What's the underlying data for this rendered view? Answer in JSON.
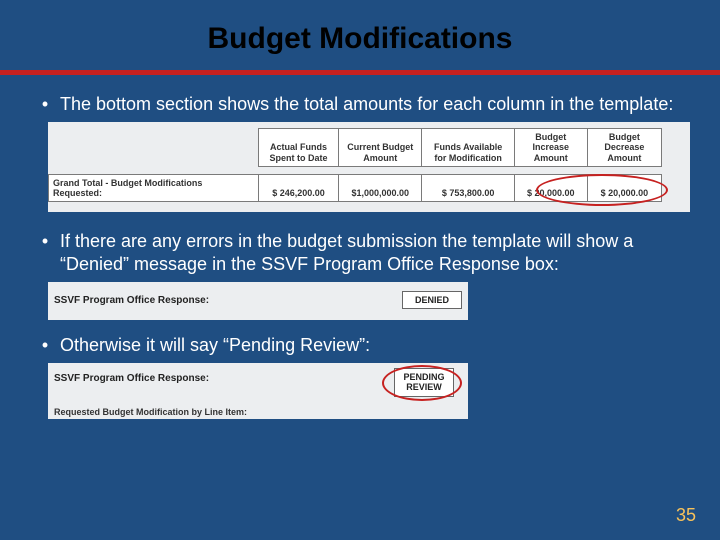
{
  "title": "Budget Modifications",
  "bullets": {
    "b1": "The bottom section shows the total amounts for each column in the template:",
    "b2": "If there are any errors in the budget submission the template will show a “Denied” message in the SSVF Program Office Response box:",
    "b3": "Otherwise it will say “Pending Review”:"
  },
  "table": {
    "headers": {
      "c1": "Actual Funds Spent to Date",
      "c2": "Current Budget Amount",
      "c3": "Funds Available for Modification",
      "c4": "Budget Increase Amount",
      "c5": "Budget Decrease Amount"
    },
    "row": {
      "label": "Grand Total - Budget Modifications Requested:",
      "c1": "$ 246,200.00",
      "c2": "$1,000,000.00",
      "c3": "$ 753,800.00",
      "c4": "$ 20,000.00",
      "c5": "$ 20,000.00"
    }
  },
  "response": {
    "label": "SSVF Program Office Response:",
    "denied": "DENIED",
    "pending_l1": "PENDING",
    "pending_l2": "REVIEW",
    "line_item_label": "Requested Budget Modification by Line Item:"
  },
  "page_number": "35"
}
